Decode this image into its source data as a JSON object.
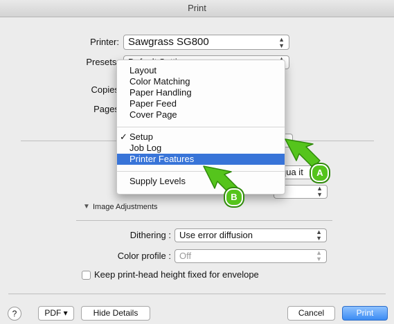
{
  "window": {
    "title": "Print"
  },
  "printer": {
    "label": "Printer:",
    "value": "Sawgrass SG800"
  },
  "presets": {
    "label": "Presets:",
    "value": "Default Settings"
  },
  "copies": {
    "label": "Copies"
  },
  "pages": {
    "label": "Pages"
  },
  "menu": {
    "items": [
      {
        "label": "Layout",
        "checked": false,
        "highlighted": false
      },
      {
        "label": "Color Matching",
        "checked": false,
        "highlighted": false
      },
      {
        "label": "Paper Handling",
        "checked": false,
        "highlighted": false
      },
      {
        "label": "Paper Feed",
        "checked": false,
        "highlighted": false
      },
      {
        "label": "Cover Page",
        "checked": false,
        "highlighted": false
      },
      {
        "label": "Setup",
        "checked": true,
        "highlighted": false
      },
      {
        "label": "Job Log",
        "checked": false,
        "highlighted": false
      },
      {
        "label": "Printer Features",
        "checked": false,
        "highlighted": true
      },
      {
        "label": "Supply Levels",
        "checked": false,
        "highlighted": false
      }
    ],
    "checkmark": "✓"
  },
  "quality": {
    "partial_text": "qua it"
  },
  "image_adjustments": {
    "label": "Image Adjustments"
  },
  "dithering": {
    "label": "Dithering :",
    "value": "Use error diffusion"
  },
  "color_profile": {
    "label": "Color profile :",
    "value": "Off"
  },
  "envelope_checkbox": {
    "label": "Keep print-head height fixed for envelope",
    "checked": false
  },
  "footer": {
    "help": "?",
    "pdf": "PDF ▾",
    "hide_details": "Hide Details",
    "cancel": "Cancel",
    "print": "Print"
  },
  "callouts": {
    "a": "A",
    "b": "B"
  },
  "colors": {
    "accent": "#3874d8",
    "callout_green": "#55c41c",
    "print_button": "#3b8bf3"
  }
}
